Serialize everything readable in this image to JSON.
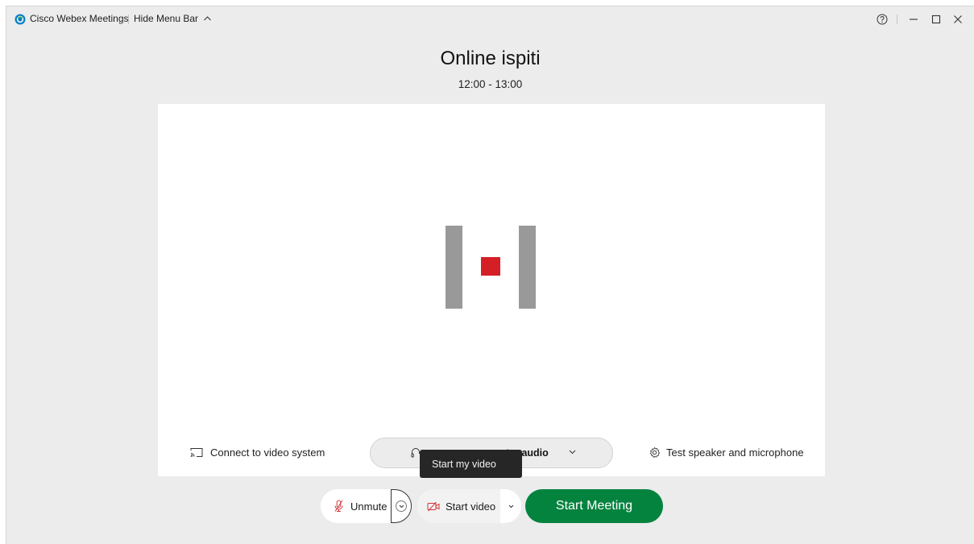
{
  "app": {
    "name": "Cisco Webex Meetings",
    "hide_menu_label": "Hide Menu Bar",
    "brand_color": "#04833f"
  },
  "window_controls": {
    "help_icon": "help-circle-icon",
    "minimize_icon": "minimize-icon",
    "maximize_icon": "maximize-icon",
    "close_icon": "close-icon"
  },
  "meeting": {
    "title": "Online ispiti",
    "time": "12:00 - 13:00"
  },
  "preview": {
    "placeholder_icon": "webex-video-off-placeholder-icon",
    "connect_label": "Connect to video system",
    "audio_label": "ter audio",
    "test_label": "Test speaker and microphone"
  },
  "tooltip": {
    "text": "Start my video"
  },
  "controls": {
    "unmute_label": "Unmute",
    "start_video_label": "Start video",
    "start_meeting_label": "Start Meeting",
    "muted_color": "#d13438"
  }
}
